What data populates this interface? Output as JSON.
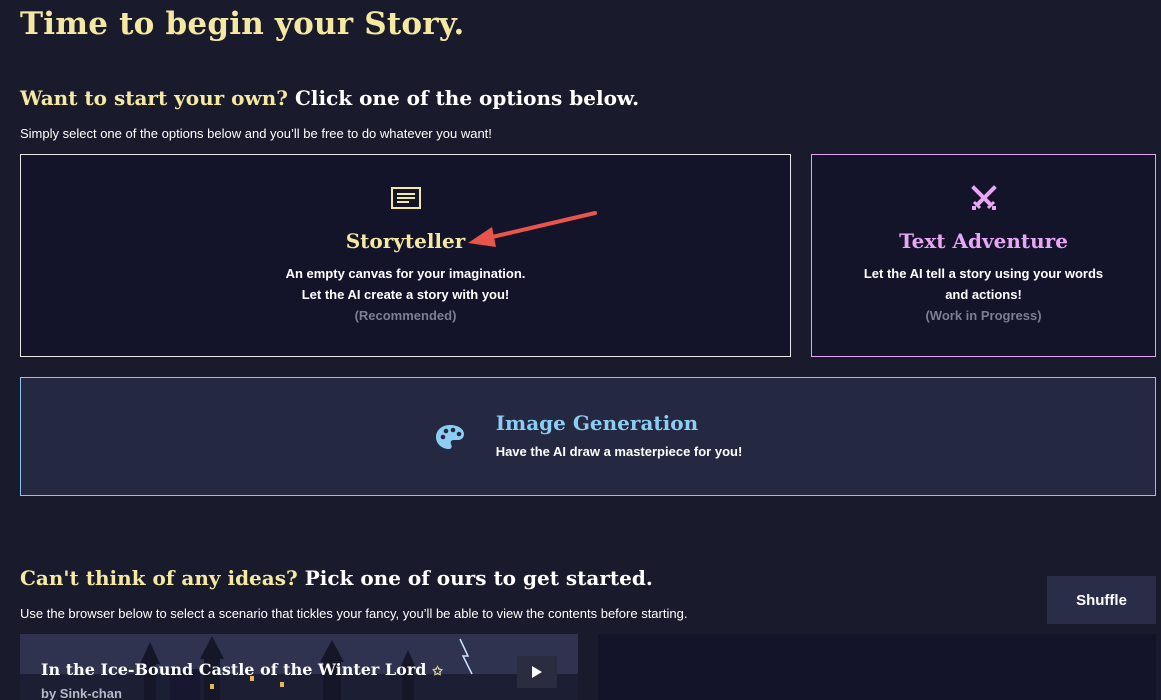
{
  "page_title": "Time to begin your Story.",
  "own_section": {
    "heading_accent": "Want to start your own?",
    "heading_rest": "Click one of the options below.",
    "subtitle": "Simply select one of the options below and you’ll be free to do whatever you want!"
  },
  "cards": {
    "storyteller": {
      "icon": "document-lines-icon",
      "title": "Storyteller",
      "line1": "An empty canvas for your imagination.",
      "line2": "Let the AI create a story with you!",
      "note": "(Recommended)"
    },
    "text_adventure": {
      "icon": "crossed-swords-icon",
      "title": "Text Adventure",
      "line1": "Let the AI tell a story using your words",
      "line2": "and actions!",
      "note": "(Work in Progress)"
    },
    "image_generation": {
      "icon": "palette-icon",
      "title": "Image Generation",
      "desc": "Have the AI draw a masterpiece for you!"
    }
  },
  "ideas_section": {
    "heading_accent": "Can't think of any ideas?",
    "heading_rest": "Pick one of ours to get started.",
    "subtitle": "Use the browser below to select a scenario that tickles your fancy, you’ll be able to view the contents before starting.",
    "shuffle_label": "Shuffle"
  },
  "scenario": {
    "title": "In the Ice-Bound Castle of the Winter Lord",
    "author": "by Sink-chan"
  },
  "colors": {
    "background": "#191a2b",
    "accent_yellow": "#f5e9a2",
    "accent_pink": "#e7a7f4",
    "accent_blue": "#8ccdf3",
    "annotation_arrow": "#e8554b"
  }
}
